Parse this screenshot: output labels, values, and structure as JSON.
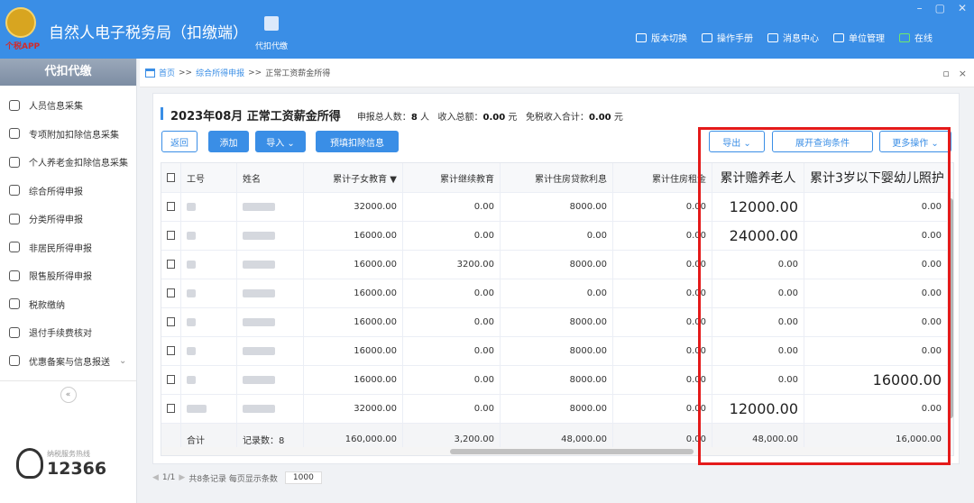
{
  "app": {
    "emblem_text": "个税APP",
    "title": "自然人电子税务局（扣缴端）",
    "deduct_tab_label": "代扣代缴",
    "nav": [
      {
        "label": "版本切换",
        "icon": "switch-icon"
      },
      {
        "label": "操作手册",
        "icon": "manual-icon"
      },
      {
        "label": "消息中心",
        "icon": "mail-icon"
      },
      {
        "label": "单位管理",
        "icon": "building-icon"
      },
      {
        "label": "在线",
        "icon": "online-monitor-icon"
      }
    ],
    "window_controls": [
      "–",
      "▢",
      "✕"
    ]
  },
  "sidebar": {
    "heading": "代扣代缴",
    "items": [
      {
        "label": "人员信息采集",
        "icon": "people-icon"
      },
      {
        "label": "专项附加扣除信息采集",
        "icon": "grid-icon"
      },
      {
        "label": "个人养老金扣除信息采集",
        "icon": "pension-icon"
      },
      {
        "label": "综合所得申报",
        "icon": "layers-icon"
      },
      {
        "label": "分类所得申报",
        "icon": "pie-icon"
      },
      {
        "label": "非居民所得申报",
        "icon": "person-icon"
      },
      {
        "label": "限售股所得申报",
        "icon": "bar-chart-icon"
      },
      {
        "label": "税款缴纳",
        "icon": "wallet-icon"
      },
      {
        "label": "退付手续费核对",
        "icon": "list-icon"
      },
      {
        "label": "优惠备案与信息报送",
        "icon": "doc-icon",
        "chevron": "⌄"
      }
    ],
    "collapse_label": "«",
    "hotline": {
      "label": "纳税服务热线",
      "number": "12366"
    }
  },
  "breadcrumb": {
    "home": "首页",
    "sep": ">>",
    "parent": "综合所得申报",
    "current": "正常工资薪金所得",
    "tools": [
      "▫",
      "×"
    ]
  },
  "panel": {
    "title": "2023年08月 正常工资薪金所得",
    "stats_count_label": "申报总人数：",
    "stats_count": "8",
    "stats_count_unit": "人",
    "stats_income_label": "收入总额：",
    "stats_income": "0.00",
    "stats_income_unit": "元",
    "stats_exempt_label": "免税收入合计：",
    "stats_exempt": "0.00",
    "stats_exempt_unit": "元",
    "buttons": {
      "back": "返回",
      "add": "添加",
      "import": "导入 ⌄",
      "prefill": "预填扣除信息",
      "export": "导出 ⌄",
      "expand_query": "展开查询条件",
      "more": "更多操作 ⌄"
    }
  },
  "table": {
    "headers": [
      "",
      "工号",
      "姓名",
      "累计子女教育 ▼",
      "累计继续教育",
      "累计住房贷款利息",
      "累计住房租金",
      "累计赡养老人",
      "累计3岁以下婴幼儿照护"
    ],
    "rows": [
      {
        "child_edu": "32000.00",
        "cont_edu": "0.00",
        "loan": "8000.00",
        "rent": "0.00",
        "elder": "12000.00",
        "infant": "0.00"
      },
      {
        "child_edu": "16000.00",
        "cont_edu": "0.00",
        "loan": "0.00",
        "rent": "0.00",
        "elder": "24000.00",
        "infant": "0.00"
      },
      {
        "child_edu": "16000.00",
        "cont_edu": "3200.00",
        "loan": "8000.00",
        "rent": "0.00",
        "elder": "0.00",
        "infant": "0.00"
      },
      {
        "child_edu": "16000.00",
        "cont_edu": "0.00",
        "loan": "0.00",
        "rent": "0.00",
        "elder": "0.00",
        "infant": "0.00"
      },
      {
        "child_edu": "16000.00",
        "cont_edu": "0.00",
        "loan": "8000.00",
        "rent": "0.00",
        "elder": "0.00",
        "infant": "0.00"
      },
      {
        "child_edu": "16000.00",
        "cont_edu": "0.00",
        "loan": "8000.00",
        "rent": "0.00",
        "elder": "0.00",
        "infant": "0.00"
      },
      {
        "child_edu": "16000.00",
        "cont_edu": "0.00",
        "loan": "8000.00",
        "rent": "0.00",
        "elder": "0.00",
        "infant": "16000.00"
      },
      {
        "child_edu": "32000.00",
        "cont_edu": "0.00",
        "loan": "8000.00",
        "rent": "0.00",
        "elder": "12000.00",
        "infant": "0.00"
      }
    ],
    "footer": {
      "label": "合计",
      "record_count": "记录数：8",
      "child_edu": "160,000.00",
      "cont_edu": "3,200.00",
      "loan": "48,000.00",
      "rent": "0.00",
      "elder": "48,000.00",
      "infant": "16,000.00"
    }
  },
  "pager": {
    "page": "1/1",
    "summary": "共8条记录  每页显示条数",
    "page_size": "1000"
  },
  "colors": {
    "accent": "#3a8ee6",
    "highlight": "#e41a1a"
  }
}
